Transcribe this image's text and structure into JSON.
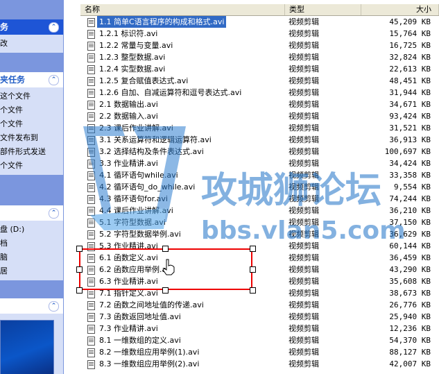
{
  "task_pane": {
    "panel1": {
      "title": "务",
      "items": [
        "改"
      ]
    },
    "panel2": {
      "title": "夹任务",
      "items": [
        "这个文件",
        "个文件",
        "个文件",
        "文件发布到",
        "部件形式发送",
        "个文件"
      ]
    },
    "panel3": {
      "items": [
        "盘 (D:)",
        "档",
        "脑",
        "居"
      ]
    }
  },
  "columns": {
    "name": "名称",
    "type": "类型",
    "size": "大小"
  },
  "rows": [
    {
      "name": "1.1 简单C语言程序的构成和格式.avi",
      "type": "视频剪辑",
      "size": "45,209 KB",
      "selected": true
    },
    {
      "name": "1.2.1 标识符.avi",
      "type": "视频剪辑",
      "size": "15,764 KB"
    },
    {
      "name": "1.2.2 常量与变量.avi",
      "type": "视频剪辑",
      "size": "16,725 KB"
    },
    {
      "name": "1.2.3 整型数据.avi",
      "type": "视频剪辑",
      "size": "32,824 KB"
    },
    {
      "name": "1.2.4 实型数据.avi",
      "type": "视频剪辑",
      "size": "22,613 KB"
    },
    {
      "name": "1.2.5 复合赋值表达式.avi",
      "type": "视频剪辑",
      "size": "48,451 KB"
    },
    {
      "name": "1.2.6 自加、自减运算符和逗号表达式.avi",
      "type": "视频剪辑",
      "size": "31,944 KB"
    },
    {
      "name": "2.1 数据输出.avi",
      "type": "视频剪辑",
      "size": "34,671 KB"
    },
    {
      "name": "2.2 数据输入.avi",
      "type": "视频剪辑",
      "size": "93,424 KB"
    },
    {
      "name": "2.3 课后作业讲解.avi",
      "type": "视频剪辑",
      "size": "31,521 KB"
    },
    {
      "name": "3.1 关系运算符和逻辑运算符.avi",
      "type": "视频剪辑",
      "size": "36,913 KB"
    },
    {
      "name": "3.2 选择结构及条件表达式.avi",
      "type": "视频剪辑",
      "size": "100,697 KB"
    },
    {
      "name": "3.3 作业精讲.avi",
      "type": "视频剪辑",
      "size": "34,424 KB"
    },
    {
      "name": "4.1 循环语句while.avi",
      "type": "视频剪辑",
      "size": "33,358 KB"
    },
    {
      "name": "4.2 循环语句_do_while.avi",
      "type": "视频剪辑",
      "size": "9,554 KB"
    },
    {
      "name": "4.3 循环语句for.avi",
      "type": "视频剪辑",
      "size": "74,244 KB"
    },
    {
      "name": "4.4 课后作业讲解.avi",
      "type": "视频剪辑",
      "size": "36,210 KB"
    },
    {
      "name": "5.1 字符型数据.avi",
      "type": "视频剪辑",
      "size": "37,150 KB"
    },
    {
      "name": "5.2 字符型数据举例.avi",
      "type": "视频剪辑",
      "size": "36,629 KB"
    },
    {
      "name": "5.3 作业精讲.avi",
      "type": "视频剪辑",
      "size": "60,144 KB"
    },
    {
      "name": "6.1 函数定义.avi",
      "type": "视频剪辑",
      "size": "36,459 KB"
    },
    {
      "name": "6.2 函数应用举例.avi",
      "type": "视频剪辑",
      "size": "43,290 KB"
    },
    {
      "name": "6.3 作业精讲.avi",
      "type": "视频剪辑",
      "size": "35,608 KB"
    },
    {
      "name": "7.1 指针定义.avi",
      "type": "视频剪辑",
      "size": "38,673 KB"
    },
    {
      "name": "7.2 函数之间地址值的传递.avi",
      "type": "视频剪辑",
      "size": "26,776 KB"
    },
    {
      "name": "7.3 函数返回地址值.avi",
      "type": "视频剪辑",
      "size": "25,940 KB"
    },
    {
      "name": "7.3 作业精讲.avi",
      "type": "视频剪辑",
      "size": "12,236 KB"
    },
    {
      "name": "8.1 一维数组的定义.avi",
      "type": "视频剪辑",
      "size": "54,370 KB"
    },
    {
      "name": "8.2 一维数组应用举例(1).avi",
      "type": "视频剪辑",
      "size": "88,127 KB"
    },
    {
      "name": "8.3 一维数组应用举例(2).avi",
      "type": "视频剪辑",
      "size": "42,007 KB"
    }
  ],
  "watermark": {
    "text1": "攻城狮论坛",
    "text2": "bbs.vlan5.com"
  }
}
